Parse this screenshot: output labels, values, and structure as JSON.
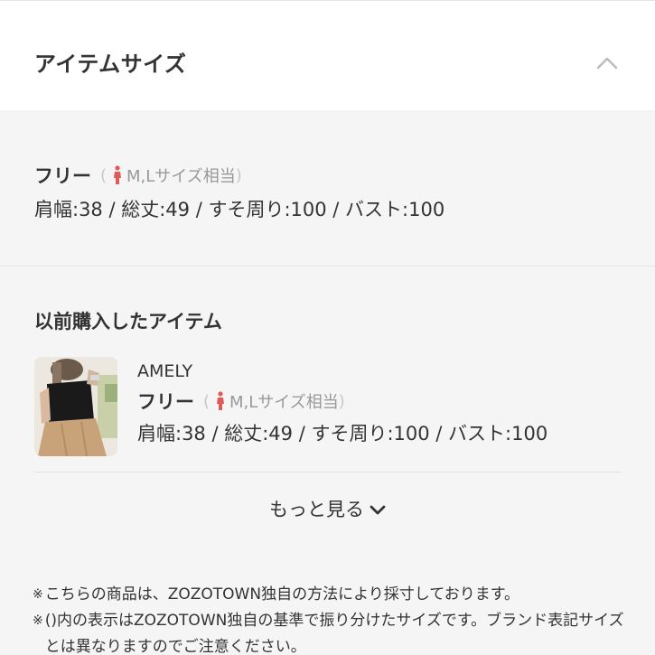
{
  "header": {
    "title": "アイテムサイズ"
  },
  "size": {
    "name": "フリー",
    "paren_open": "(",
    "equiv": "M,Lサイズ相当",
    "paren_close": ")",
    "measurements": "肩幅:38 / 総丈:49 / すそ周り:100 / バスト:100"
  },
  "previous": {
    "title": "以前購入したアイテム",
    "item": {
      "brand": "AMELY",
      "size_name": "フリー",
      "paren_open": "(",
      "equiv": "M,Lサイズ相当",
      "paren_close": ")",
      "measurements": "肩幅:38 / 総丈:49 / すそ周り:100 / バスト:100"
    },
    "more_label": "もっと見る"
  },
  "notes": {
    "mark": "※",
    "line1": "こちらの商品は、ZOZOTOWN独自の方法により採寸しております。",
    "line2": "()内の表示はZOZOTOWN独自の基準で振り分けたサイズです。ブランド表記サイズとは異なりますのでご注意ください。"
  },
  "colors": {
    "accent_person_icon": "#e05a5a",
    "text": "#333333",
    "muted": "#999999"
  },
  "icons": {
    "collapse": "chevron-up-icon",
    "size_equiv": "person-icon",
    "more": "chevron-down-icon"
  }
}
